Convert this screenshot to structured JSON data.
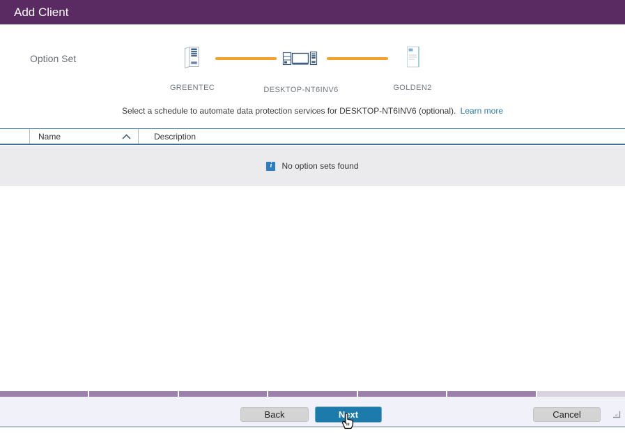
{
  "dialog": {
    "title": "Add Client"
  },
  "option_set": {
    "label": "Option Set",
    "nodes": [
      {
        "name": "GREENTEC",
        "icon": "server-icon"
      },
      {
        "name": "DESKTOP-NT6INV6",
        "icon": "client-systems-icon"
      },
      {
        "name": "GOLDEN2",
        "icon": "option-set-document-icon"
      }
    ],
    "hint_text": "Select a schedule to automate data protection services for DESKTOP-NT6INV6 (optional).",
    "hint_link": "Learn more"
  },
  "table": {
    "name_column": "Name",
    "description_column": "Description",
    "sort_direction": "ascending",
    "empty_message": "No option sets found",
    "info_icon_glyph": "i"
  },
  "wizard": {
    "segments": [
      "done",
      "done",
      "done",
      "done",
      "done",
      "done",
      "current"
    ]
  },
  "footer": {
    "back_label": "Back",
    "next_label": "Next",
    "cancel_label": "Cancel"
  },
  "colors": {
    "titlebar": "#5a2a62",
    "connector-orange": "#f2a231",
    "table-border-blue": "#3d6f9e",
    "link-blue": "#2a7ab5",
    "primary-button": "#1c7bab",
    "info-blue": "#2e7cc0",
    "wizard-done": "#9e80ad",
    "wizard-current": "#d9d3e1",
    "footer-bg": "#f1f2f9"
  }
}
